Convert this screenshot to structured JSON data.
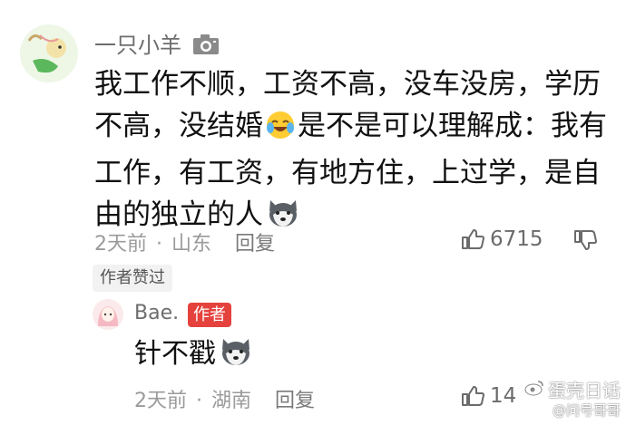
{
  "comment": {
    "username": "一只小羊",
    "text": "我工作不顺，工资不高，没车没房，学历不高，没结婚",
    "text_after_emoji": "是不是可以理解成：我有工作，有工资，有地方住，上过学，是自由的独立的人",
    "emoji_1": "crying-laughing-emoji",
    "emoji_2": "husky-dog-emoji",
    "time": "2天前",
    "separator": "·",
    "location": "山东",
    "reply_label": "回复",
    "like_count": "6715",
    "author_liked": "作者赞过"
  },
  "reply": {
    "username": "Bae.",
    "author_badge": "作者",
    "text": "针不戳",
    "emoji": "husky-dog-emoji",
    "time": "2天前",
    "separator": "·",
    "location": "湖南",
    "reply_label": "回复",
    "like_count": "14"
  },
  "watermark": {
    "line1": "蛋壳日话",
    "line2": "@问号哥哥"
  },
  "colors": {
    "author_badge_bg": "#e5423e",
    "meta_text": "#9a9a9a",
    "body_text": "#111111"
  }
}
